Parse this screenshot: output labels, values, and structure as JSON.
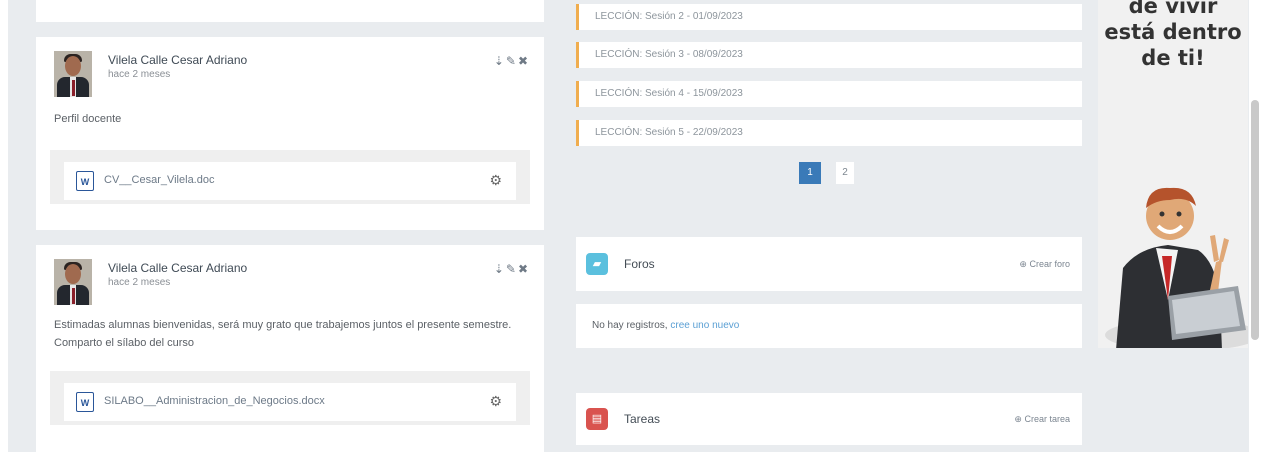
{
  "posts": [
    {
      "author": "Vilela Calle Cesar Adriano",
      "time": "hace 2 meses",
      "text": "Perfil docente",
      "attachment": "CV__Cesar_Vilela.doc"
    },
    {
      "author": "Vilela Calle Cesar Adriano",
      "time": "hace 2 meses",
      "text": "Estimadas alumnas bienvenidas, será muy grato que trabajemos juntos el presente semestre. Comparto el sílabo del curso",
      "attachment": "SILABO__Administracion_de_Negocios.docx"
    }
  ],
  "lessons": [
    "LECCIÓN: Sesión 2 - 01/09/2023",
    "LECCIÓN: Sesión 3 - 08/09/2023",
    "LECCIÓN: Sesión 4 - 15/09/2023",
    "LECCIÓN: Sesión 5 - 22/09/2023"
  ],
  "pagination": {
    "pages": [
      "1",
      "2"
    ],
    "current": "1"
  },
  "foros": {
    "title": "Foros",
    "action": "Crear foro",
    "empty_text": "No hay registros, ",
    "empty_link": "cree uno nuevo"
  },
  "tareas": {
    "title": "Tareas",
    "action": "Crear tarea"
  },
  "ad": {
    "lines": [
      "de vivir",
      "está dentro",
      "de ti!"
    ]
  },
  "colors": {
    "lesson_accent": "#f0ad4e",
    "page_active": "#3a7ab8",
    "foros_icon": "#5bc0de",
    "tareas_icon": "#d9534f",
    "word_blue": "#2a5699"
  },
  "icons": {
    "attachment": "word-doc-icon",
    "attachment_action": "gear-icon",
    "post_actions": [
      "pin-icon",
      "pencil-icon",
      "close-icon"
    ],
    "foros": "chat-icon",
    "tareas": "tasks-icon",
    "create": "plus-circle-icon"
  }
}
